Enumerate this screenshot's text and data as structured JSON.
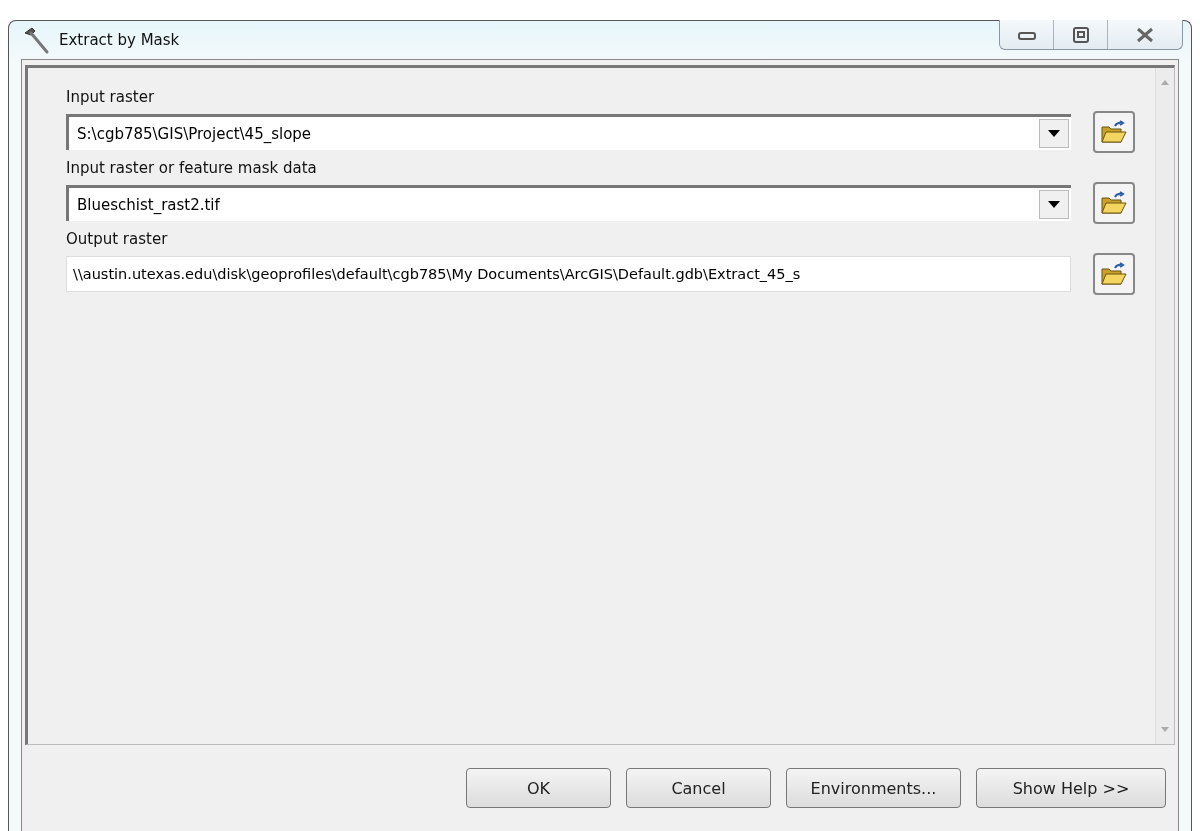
{
  "window": {
    "title": "Extract by Mask"
  },
  "fields": [
    {
      "label": "Input raster",
      "kind": "dropdown",
      "value": "S:\\cgb785\\GIS\\Project\\45_slope"
    },
    {
      "label": "Input raster or feature mask data",
      "kind": "dropdown",
      "value": "Blueschist_rast2.tif"
    },
    {
      "label": "Output raster",
      "kind": "text",
      "value": "\\\\austin.utexas.edu\\disk\\geoprofiles\\default\\cgb785\\My Documents\\ArcGIS\\Default.gdb\\Extract_45_s"
    }
  ],
  "buttons": [
    "OK",
    "Cancel",
    "Environments...",
    "Show Help >>"
  ]
}
